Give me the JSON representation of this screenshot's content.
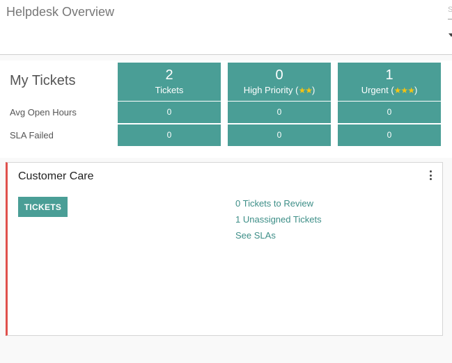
{
  "header": {
    "title": "Helpdesk Overview",
    "search_placeholder": "S"
  },
  "my_tickets": {
    "title": "My Tickets",
    "row_labels": [
      "Avg Open Hours",
      "SLA Failed"
    ],
    "columns": [
      {
        "count": "2",
        "label": "Tickets",
        "stars": "",
        "avg_open_hours": "0",
        "sla_failed": "0"
      },
      {
        "count": "0",
        "label": "High Priority (",
        "stars": "★★",
        "suffix": ")",
        "avg_open_hours": "0",
        "sla_failed": "0"
      },
      {
        "count": "1",
        "label": "Urgent (",
        "stars": "★★★",
        "suffix": ")",
        "avg_open_hours": "0",
        "sla_failed": "0"
      }
    ]
  },
  "team": {
    "name": "Customer Care",
    "button_label": "TICKETS",
    "links": [
      "0 Tickets to Review",
      "1 Unassigned Tickets",
      "See SLAs"
    ]
  },
  "colors": {
    "accent": "#4a9e96",
    "card_border": "#e0504c",
    "star": "#f2c314"
  }
}
